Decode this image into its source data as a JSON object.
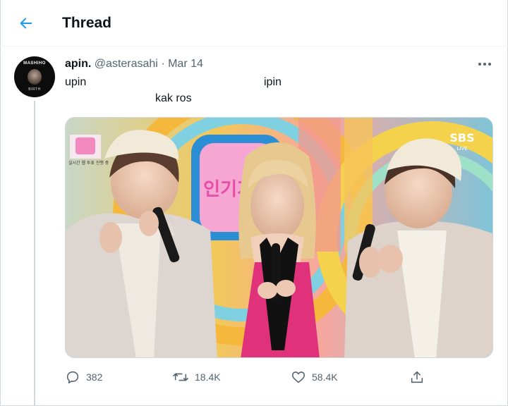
{
  "header": {
    "title": "Thread"
  },
  "tweet": {
    "author": {
      "name": "apin.",
      "handle": "@asterasahi",
      "separator": "·",
      "date": "Mar 14",
      "avatar_top_text": "MASHIHO",
      "avatar_bottom_text": "BIRTH"
    },
    "text": {
      "line1_left": "upin",
      "line1_right": "ipin",
      "line2": "kak ros"
    },
    "media": {
      "corner_logo": "SBS",
      "corner_logo_sub": "LIVE",
      "studio_sign": "인기가요",
      "inset_caption": "실시간 웹 투표 진행 중",
      "mic_label": "인기가요"
    },
    "stats": {
      "replies": "382",
      "retweets": "18.4K",
      "likes": "58.4K"
    }
  },
  "colors": {
    "accent": "#1d9bf0",
    "secondary_text": "#536471",
    "border": "#cfd9de"
  }
}
